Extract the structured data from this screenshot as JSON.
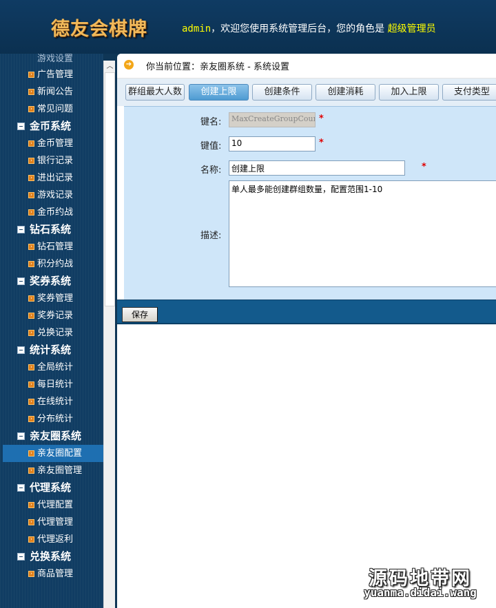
{
  "header": {
    "logo": "德友会棋牌",
    "welcome_user": "admin",
    "welcome_text": "，欢迎您使用系统管理后台，您的角色是",
    "role": "超级管理员"
  },
  "sidebar": {
    "cut_item": "游戏设置",
    "menu": [
      {
        "type": "item",
        "label": "广告管理"
      },
      {
        "type": "item",
        "label": "新闻公告"
      },
      {
        "type": "item",
        "label": "常见问题"
      },
      {
        "type": "group",
        "label": "金币系统"
      },
      {
        "type": "item",
        "label": "金币管理"
      },
      {
        "type": "item",
        "label": "银行记录"
      },
      {
        "type": "item",
        "label": "进出记录"
      },
      {
        "type": "item",
        "label": "游戏记录"
      },
      {
        "type": "item",
        "label": "金币约战"
      },
      {
        "type": "group",
        "label": "钻石系统"
      },
      {
        "type": "item",
        "label": "钻石管理"
      },
      {
        "type": "item",
        "label": "积分约战"
      },
      {
        "type": "group",
        "label": "奖券系统"
      },
      {
        "type": "item",
        "label": "奖券管理"
      },
      {
        "type": "item",
        "label": "奖券记录"
      },
      {
        "type": "item",
        "label": "兑换记录"
      },
      {
        "type": "group",
        "label": "统计系统"
      },
      {
        "type": "item",
        "label": "全局统计"
      },
      {
        "type": "item",
        "label": "每日统计"
      },
      {
        "type": "item",
        "label": "在线统计"
      },
      {
        "type": "item",
        "label": "分布统计"
      },
      {
        "type": "group",
        "label": "亲友圈系统"
      },
      {
        "type": "item",
        "label": "亲友圈配置",
        "active": true
      },
      {
        "type": "item",
        "label": "亲友圈管理"
      },
      {
        "type": "group",
        "label": "代理系统"
      },
      {
        "type": "item",
        "label": "代理配置"
      },
      {
        "type": "item",
        "label": "代理管理"
      },
      {
        "type": "item",
        "label": "代理返利"
      },
      {
        "type": "group",
        "label": "兑换系统"
      },
      {
        "type": "item",
        "label": "商品管理"
      }
    ]
  },
  "breadcrumb": "你当前位置：亲友圈系统 - 系统设置",
  "tabs": [
    {
      "label": "群组最大人数"
    },
    {
      "label": "创建上限",
      "active": true
    },
    {
      "label": "创建条件"
    },
    {
      "label": "创建消耗"
    },
    {
      "label": "加入上限"
    },
    {
      "label": "支付类型"
    }
  ],
  "form": {
    "key_label": "键名:",
    "key_value": "MaxCreateGroupCount",
    "value_label": "键值:",
    "value_value": "10",
    "name_label": "名称:",
    "name_value": "创建上限",
    "desc_label": "描述:",
    "desc_value": "单人最多能创建群组数量，配置范围1-10",
    "required_mark": "*"
  },
  "save_label": "保存",
  "watermark": {
    "title": "源码地带网",
    "url": "yuanma.didai.wang"
  },
  "colors": {
    "header_bg": "#0f3b63",
    "sidebar_bg": "#113d63",
    "active_item": "#1e6fb1",
    "form_bg": "#cfe6f9",
    "save_bar": "#135a8c",
    "logo": "#f1b95a",
    "highlight_text": "#ffff00",
    "required": "#e00000"
  }
}
